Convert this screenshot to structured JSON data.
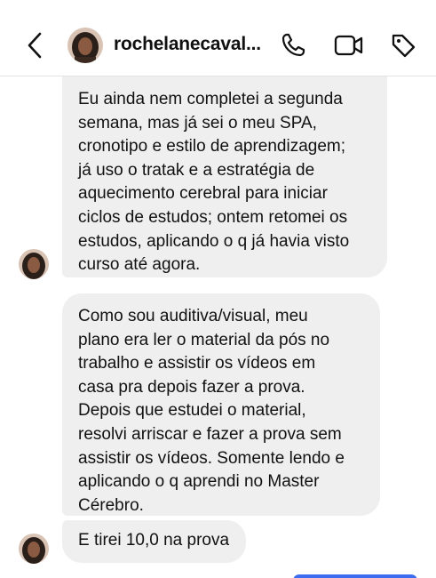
{
  "header": {
    "username": "rochelanecaval..."
  },
  "icons": {
    "back": "chevron-left-icon",
    "call": "phone-icon",
    "video": "video-camera-icon",
    "tag": "tag-icon"
  },
  "colors": {
    "bubble_received": "#efefef",
    "text": "#111111",
    "sent_bubble": "#3d6cf0"
  },
  "messages": [
    {
      "text": "Eu ainda nem completei a segunda\nsemana, mas já sei o meu SPA,\ncronotipo e estilo de aprendizagem;\njá uso o tratak e a estratégia de\naquecimento cerebral para iniciar\nciclos de estudos; ontem retomei os\nestudos, aplicando o q já havia visto\ncurso até agora."
    },
    {
      "text": "Como sou auditiva/visual, meu\nplano era ler o material da pós no\ntrabalho e assistir os vídeos em\ncasa pra depois fazer a prova.\nDepois que estudei o material,\nresolvi arriscar e fazer a prova sem\nassistir os vídeos. Somente lendo e\naplicando o q aprendi no Master\nCérebro."
    },
    {
      "text": "E tirei 10,0 na prova"
    }
  ]
}
